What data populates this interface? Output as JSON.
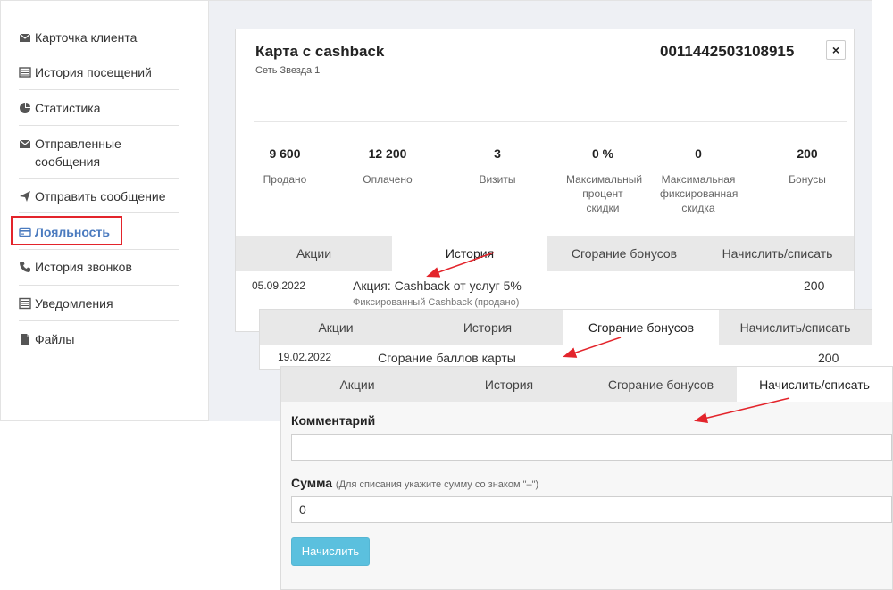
{
  "sidebar": {
    "items": [
      {
        "label": "Карточка клиента",
        "icon": "envelope-icon"
      },
      {
        "label": "История посещений",
        "icon": "list-icon"
      },
      {
        "label": "Статистика",
        "icon": "pie-chart-icon"
      },
      {
        "label": "Отправленные сообщения",
        "icon": "envelope-icon"
      },
      {
        "label": "Отправить сообщение",
        "icon": "send-icon"
      },
      {
        "label": "Лояльность",
        "icon": "credit-card-icon"
      },
      {
        "label": "История звонков",
        "icon": "phone-icon"
      },
      {
        "label": "Уведомления",
        "icon": "list-icon"
      },
      {
        "label": "Файлы",
        "icon": "file-icon"
      }
    ],
    "active_index": 5
  },
  "card": {
    "title": "Карта с cashback",
    "subtitle": "Сеть Звезда 1",
    "number": "0011442503108915",
    "close_label": "×",
    "stats": [
      {
        "value": "9 600",
        "label": "Продано"
      },
      {
        "value": "12 200",
        "label": "Оплачено"
      },
      {
        "value": "3",
        "label": "Визиты"
      },
      {
        "value": "0 %",
        "label": "Максимальный процент скидки"
      },
      {
        "value": "0",
        "label": "Максимальная фиксированная скидка"
      },
      {
        "value": "200",
        "label": "Бонусы"
      }
    ]
  },
  "tabs": [
    "Акции",
    "История",
    "Сгорание бонусов",
    "Начислить/списать"
  ],
  "history": {
    "date": "05.09.2022",
    "text": "Акция: Cashback от услуг 5%",
    "sub": "Фиксированный Cashback (продано)",
    "amount": "200"
  },
  "burn": {
    "date": "19.02.2022",
    "text": "Сгорание баллов карты",
    "amount": "200"
  },
  "form": {
    "comment_label": "Комментарий",
    "comment_value": "",
    "sum_label": "Сумма",
    "sum_hint": "(Для списания укажите сумму со знаком \"–\")",
    "sum_value": "0",
    "submit_label": "Начислить"
  },
  "colors": {
    "accent": "#4b7bbf",
    "highlight": "#e3242b",
    "button": "#5bc0de"
  }
}
